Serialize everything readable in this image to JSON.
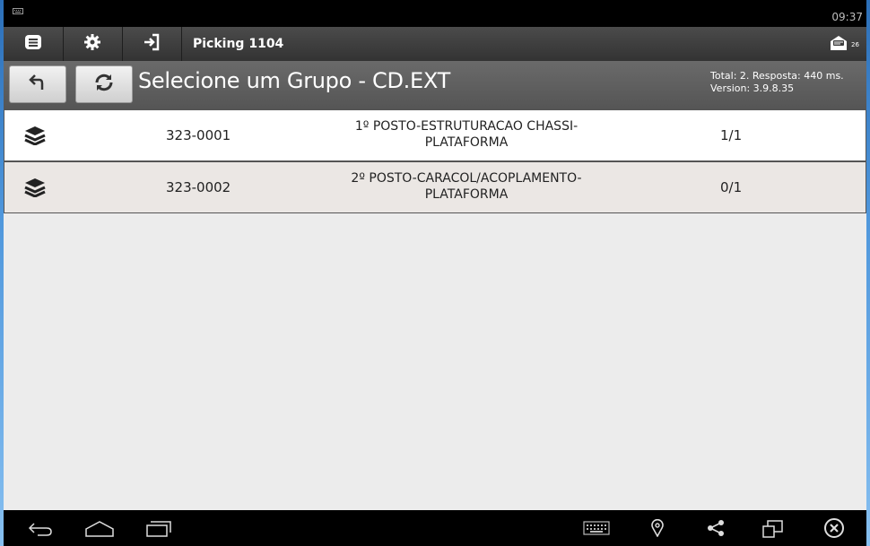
{
  "status": {
    "time": "09:37"
  },
  "toolbar": {
    "title": "Picking 1104",
    "message_count": "26"
  },
  "header": {
    "title": "Selecione um Grupo - CD.EXT",
    "info_line1": "Total: 2. Resposta: 440 ms.",
    "info_line2": "Version: 3.9.8.35"
  },
  "groups": [
    {
      "code": "323-0001",
      "desc_line1": "1º POSTO-ESTRUTURACAO CHASSI-",
      "desc_line2": "PLATAFORMA",
      "qty": "1/1"
    },
    {
      "code": "323-0002",
      "desc_line1": "2º POSTO-CARACOL/ACOPLAMENTO-",
      "desc_line2": "PLATAFORMA",
      "qty": "0/1"
    }
  ],
  "colors": {
    "row_selected": "#ebe7e4",
    "row_default": "#ffffff",
    "toolbar": "#3d3d3d",
    "header": "#5f5f5f"
  },
  "icons": {
    "toolbar": [
      "menu-icon",
      "gear-icon",
      "login-icon",
      "message-icon"
    ],
    "header": [
      "back-icon",
      "refresh-icon"
    ],
    "row": "layers-icon",
    "nav": [
      "back-nav-icon",
      "home-nav-icon",
      "recents-nav-icon",
      "keyboard-icon",
      "location-icon",
      "share-icon",
      "screen-icon",
      "close-icon"
    ]
  }
}
